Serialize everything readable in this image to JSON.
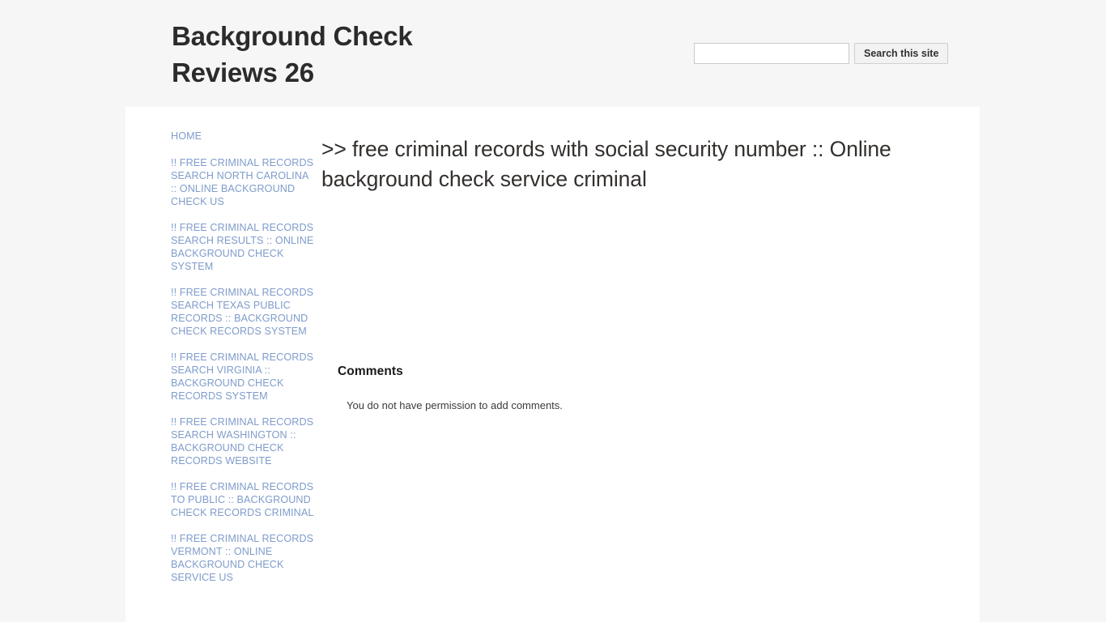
{
  "header": {
    "site_title": "Background Check Reviews 26",
    "search": {
      "value": "",
      "placeholder": "",
      "button_label": "Search this site"
    }
  },
  "sidebar": {
    "items": [
      {
        "label": "HOME"
      },
      {
        "label": "!! FREE CRIMINAL RECORDS SEARCH NORTH CAROLINA :: ONLINE BACKGROUND CHECK US"
      },
      {
        "label": "!! FREE CRIMINAL RECORDS SEARCH RESULTS :: ONLINE BACKGROUND CHECK SYSTEM"
      },
      {
        "label": "!! FREE CRIMINAL RECORDS SEARCH TEXAS PUBLIC RECORDS :: BACKGROUND CHECK RECORDS SYSTEM"
      },
      {
        "label": "!! FREE CRIMINAL RECORDS SEARCH VIRGINIA :: BACKGROUND CHECK RECORDS SYSTEM"
      },
      {
        "label": "!! FREE CRIMINAL RECORDS SEARCH WASHINGTON :: BACKGROUND CHECK RECORDS WEBSITE"
      },
      {
        "label": "!! FREE CRIMINAL RECORDS TO PUBLIC :: BACKGROUND CHECK RECORDS CRIMINAL"
      },
      {
        "label": "!! FREE CRIMINAL RECORDS VERMONT :: ONLINE BACKGROUND CHECK SERVICE US"
      }
    ]
  },
  "main": {
    "post_title": ">> free criminal records with social security number :: Online background check service criminal",
    "post_body": "",
    "comments": {
      "heading": "Comments",
      "permission_note": "You do not have permission to add comments."
    }
  },
  "colors": {
    "page_background": "#f6f6f6",
    "content_background": "#ffffff",
    "link": "#7f9ccb",
    "title": "#2b2b2b",
    "heading": "#33302e"
  }
}
